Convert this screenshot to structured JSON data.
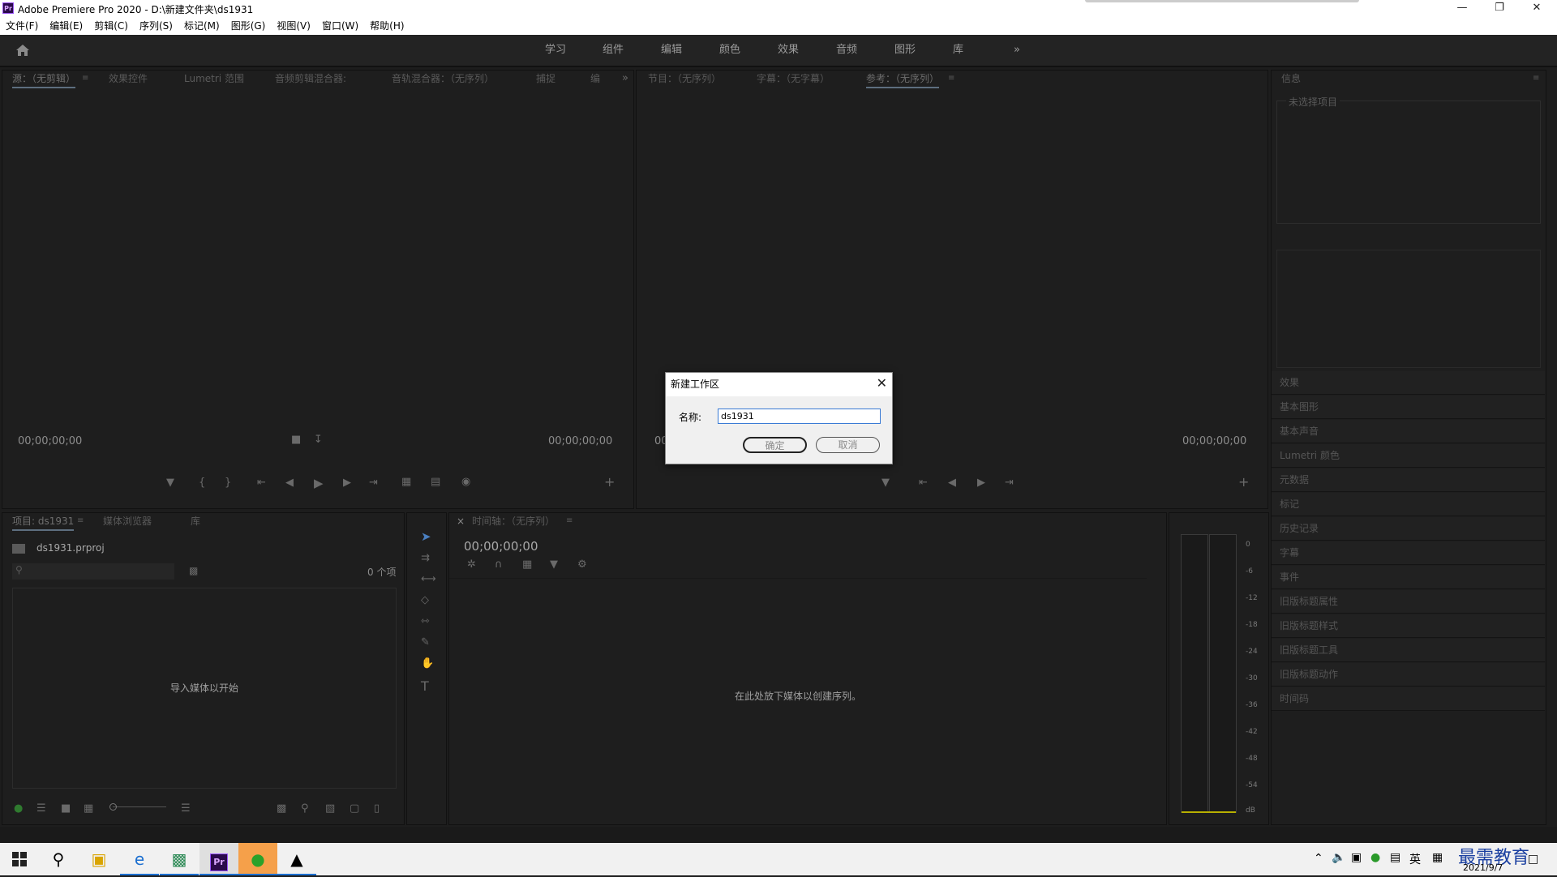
{
  "titlebar": {
    "logo": "Pr",
    "title": "Adobe Premiere Pro 2020 - D:\\新建文件夹\\ds1931"
  },
  "menu": [
    "文件(F)",
    "编辑(E)",
    "剪辑(C)",
    "序列(S)",
    "标记(M)",
    "图形(G)",
    "视图(V)",
    "窗口(W)",
    "帮助(H)"
  ],
  "workspaces": [
    "学习",
    "组件",
    "编辑",
    "颜色",
    "效果",
    "音频",
    "图形",
    "库"
  ],
  "source_panel": {
    "tabs": [
      "源：（无剪辑）",
      "效果控件",
      "Lumetri 范围",
      "音频剪辑混合器:",
      "音轨混合器：（无序列）",
      "捕捉",
      "编"
    ],
    "timecode_left": "00;00;00;00",
    "timecode_right": "00;00;00;00"
  },
  "program_panel": {
    "tabs": [
      "节目：（无序列）",
      "字幕：（无字幕）",
      "参考：（无序列）"
    ],
    "timecode_left": "00",
    "timecode_right": "00;00;00;00"
  },
  "info_panel": {
    "tab": "信息",
    "group_label": "未选择项目"
  },
  "right_list": [
    "效果",
    "基本图形",
    "基本声音",
    "Lumetri 颜色",
    "元数据",
    "标记",
    "历史记录",
    "字幕",
    "事件",
    "旧版标题属性",
    "旧版标题样式",
    "旧版标题工具",
    "旧版标题动作",
    "时间码"
  ],
  "project_panel": {
    "tabs": [
      "项目: ds1931",
      "媒体浏览器",
      "库"
    ],
    "file": "ds1931.prproj",
    "count": "0 个项",
    "empty": "导入媒体以开始"
  },
  "timeline_panel": {
    "tab": "时间轴：（无序列）",
    "close": "×",
    "timecode": "00;00;00;00",
    "empty": "在此处放下媒体以创建序列。"
  },
  "audio_meter": {
    "scale": [
      "0",
      "-6",
      "-12",
      "-18",
      "-24",
      "-30",
      "-36",
      "-42",
      "-48",
      "-54",
      "dB"
    ]
  },
  "dialog": {
    "title": "新建工作区",
    "close": "✕",
    "name_label": "名称:",
    "name_value": "ds1931",
    "ok": "确定",
    "cancel": "取消"
  },
  "taskbar": {
    "lang": "英",
    "date": "2021/9/7",
    "watermark": "最需教育"
  }
}
